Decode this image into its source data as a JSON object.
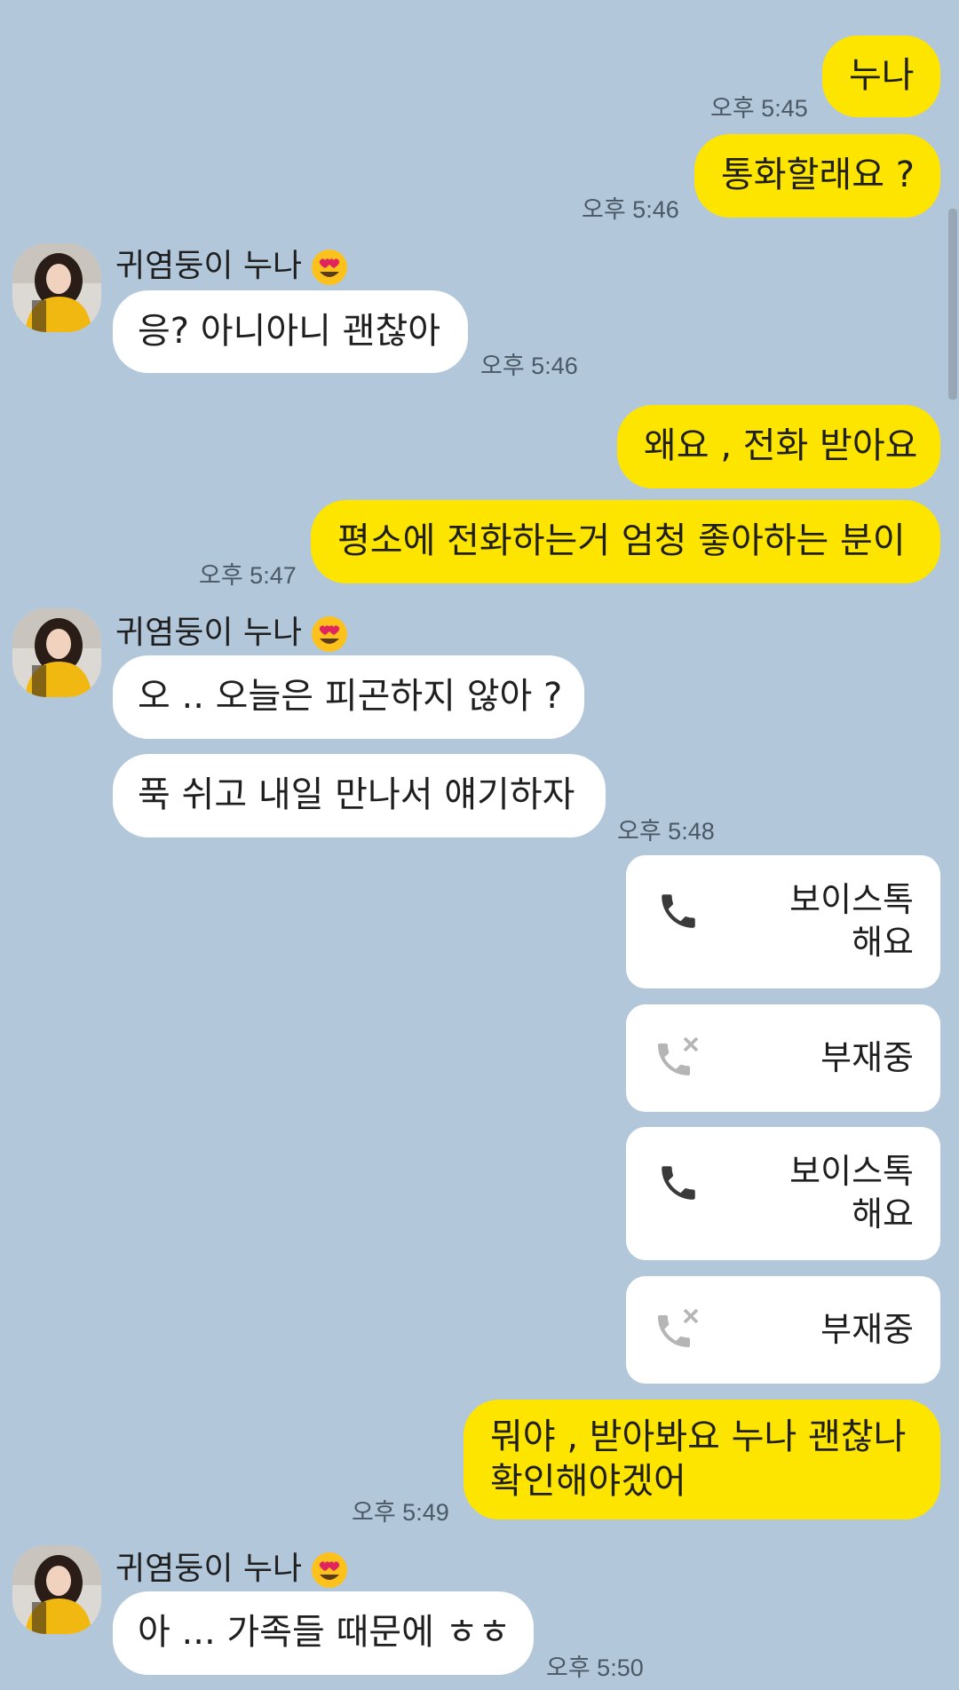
{
  "chat": {
    "contact_name": "귀염둥이 누나",
    "messages": [
      {
        "from": "me",
        "text": "누나",
        "time": "오후 5:45"
      },
      {
        "from": "me",
        "text": "통화할래요 ?",
        "time": "오후 5:46"
      },
      {
        "from": "them",
        "text": "응? 아니아니 괜찮아",
        "time": "오후 5:46"
      },
      {
        "from": "me",
        "text": "왜요 , 전화 받아요",
        "time": ""
      },
      {
        "from": "me",
        "text": "평소에 전화하는거 엄청 좋아하는 분이",
        "time": "오후 5:47"
      },
      {
        "from": "them",
        "text": "오 .. 오늘은 피곤하지 않아 ?",
        "time": ""
      },
      {
        "from": "them",
        "text": "푹 쉬고 내일 만나서 얘기하자",
        "time": "오후 5:48"
      },
      {
        "from": "me",
        "text": "뭐야 , 받아봐요 누나 괜찮나 확인해야겠어",
        "time": "오후 5:49"
      },
      {
        "from": "them",
        "text": "아 ... 가족들 때문에 ㅎㅎ",
        "time": "오후 5:50"
      }
    ],
    "calls": [
      {
        "label": "보이스톡\n해요",
        "icon": "phone-icon"
      },
      {
        "label": "부재중",
        "icon": "missed-call-icon"
      },
      {
        "label": "보이스톡\n해요",
        "icon": "phone-icon"
      },
      {
        "label": "부재중",
        "icon": "missed-call-icon"
      }
    ],
    "colors": {
      "background": "#b2c7da",
      "my_bubble": "#fee500",
      "their_bubble": "#ffffff"
    }
  }
}
